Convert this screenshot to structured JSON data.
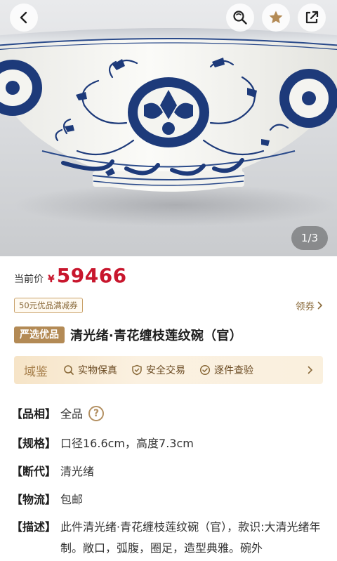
{
  "gallery": {
    "page_indicator": "1/3",
    "top_actions": [
      "back-icon",
      "search-icon",
      "star-icon",
      "share-icon"
    ]
  },
  "price": {
    "label": "当前价",
    "currency": "¥",
    "value": "59466"
  },
  "coupon": {
    "tag": "50元优品满减券",
    "link": "领券"
  },
  "product": {
    "badge": "严选优品",
    "title": "清光绪·青花缠枝莲纹碗（官）"
  },
  "guarantee": {
    "brand": "域鉴",
    "items": [
      "实物保真",
      "安全交易",
      "逐件查验"
    ]
  },
  "attributes": {
    "condition": {
      "key": "【品相】",
      "value": "全品"
    },
    "size": {
      "key": "【规格】",
      "value": "口径16.6cm，高度7.3cm"
    },
    "dynasty": {
      "key": "【断代】",
      "value": "清光绪"
    },
    "shipping": {
      "key": "【物流】",
      "value": "包邮"
    },
    "description": {
      "key": "【描述】",
      "value": "此件清光绪·青花缠枝莲纹碗（官），款识:大清光绪年制。敞口，弧腹，圈足，造型典雅。碗外"
    }
  },
  "colors": {
    "price_red": "#c8162d",
    "gold_accent": "#b38a55",
    "guarantee_bg": "#f8ead3",
    "porcelain_blue": "#1d3a7a"
  }
}
